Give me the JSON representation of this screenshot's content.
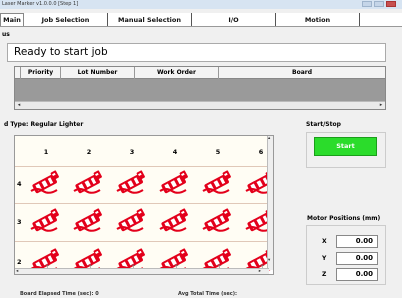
{
  "window": {
    "title": "Laser Marker v1.0.0.0 [Step 1]"
  },
  "tabs": [
    {
      "label": "Main"
    },
    {
      "label": "Job Selection"
    },
    {
      "label": "Manual Selection"
    },
    {
      "label": "I/O"
    },
    {
      "label": "Motion"
    }
  ],
  "status": {
    "section_label": "us",
    "message": "Ready to start job"
  },
  "job_grid": {
    "columns": [
      "Priority",
      "Lot Number",
      "Work Order",
      "Board"
    ]
  },
  "board": {
    "type_label": "d Type: Regular Lighter",
    "columns": [
      "1",
      "2",
      "3",
      "4",
      "5",
      "6"
    ],
    "rows": [
      "4",
      "3",
      "2"
    ],
    "plus_marker": "+",
    "cell_icon": "lighter-icon",
    "cell_color": "#e3001b"
  },
  "start_stop": {
    "label": "Start/Stop",
    "button": "Start",
    "button_color": "#2bdc2b"
  },
  "motor": {
    "label": "Motor Positions (mm)",
    "axes": [
      {
        "name": "X",
        "value": "0.00"
      },
      {
        "name": "Y",
        "value": "0.00"
      },
      {
        "name": "Z",
        "value": "0.00"
      }
    ]
  },
  "footer": {
    "left": "Board Elapsed Time (sec): 0",
    "right": "Avg Total Time (sec):"
  }
}
